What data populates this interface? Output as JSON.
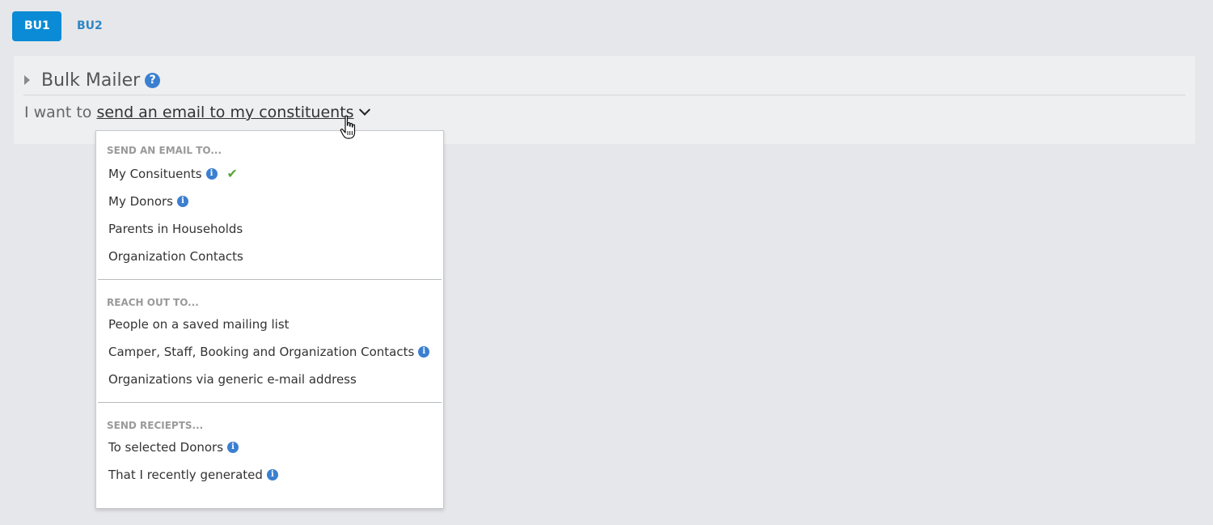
{
  "tabs": [
    {
      "label": "BU1",
      "active": true
    },
    {
      "label": "BU2",
      "active": false
    }
  ],
  "panel": {
    "title": "Bulk Mailer",
    "help_icon": "?",
    "want_prefix": "I want to",
    "want_selection": "send an email to my constituents"
  },
  "dropdown": {
    "sections": [
      {
        "label": "SEND AN EMAIL TO...",
        "items": [
          {
            "label": "My Consituents",
            "info": true,
            "selected": true
          },
          {
            "label": "My Donors",
            "info": true,
            "selected": false
          },
          {
            "label": "Parents in Households",
            "info": false,
            "selected": false
          },
          {
            "label": "Organization Contacts",
            "info": false,
            "selected": false
          }
        ]
      },
      {
        "label": "REACH OUT TO...",
        "items": [
          {
            "label": "People on a saved mailing list",
            "info": false,
            "selected": false
          },
          {
            "label": "Camper, Staff, Booking and Organization Contacts",
            "info": true,
            "selected": false
          },
          {
            "label": "Organizations via generic e-mail address",
            "info": false,
            "selected": false
          }
        ]
      },
      {
        "label": "SEND RECIEPTS...",
        "items": [
          {
            "label": "To selected Donors",
            "info": true,
            "selected": false
          },
          {
            "label": "That I recently generated",
            "info": true,
            "selected": false
          }
        ]
      }
    ]
  },
  "icons": {
    "info": "i",
    "check": "✔"
  },
  "colors": {
    "accent": "#0b8bd5",
    "link": "#2e86c4",
    "info": "#3b7fd0",
    "check": "#5aa832"
  }
}
